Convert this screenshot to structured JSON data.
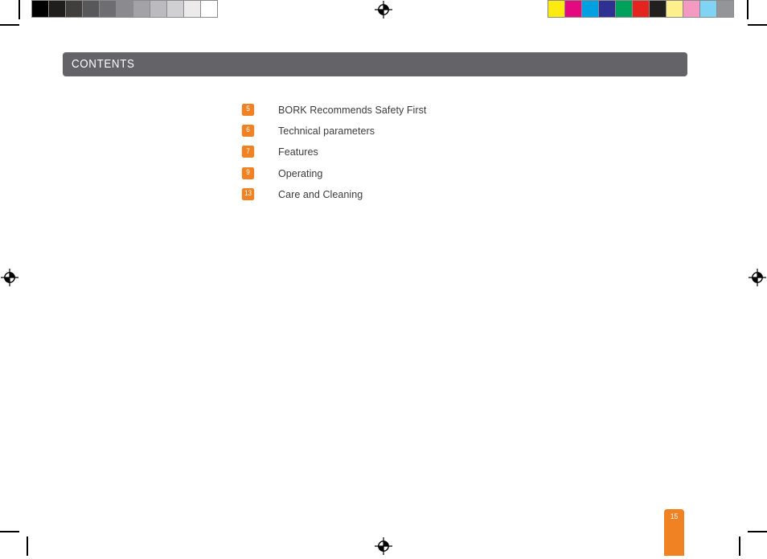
{
  "document": {
    "page_number": "15",
    "header_title": "CONTENTS",
    "header_color": "#636368",
    "accent_color": "#f08223",
    "text_color": "#3b3b3d"
  },
  "contents": {
    "entries": [
      {
        "page": "5",
        "label": "BORK Recommends Safety First"
      },
      {
        "page": "6",
        "label": "Technical parameters"
      },
      {
        "page": "7",
        "label": "Features"
      },
      {
        "page": "9",
        "label": "Operating"
      },
      {
        "page": "13",
        "label": "Care and Cleaning"
      }
    ]
  },
  "print_marks": {
    "grayscale_strip": [
      "#000000",
      "#1f1e1d",
      "#403f3e",
      "#58575a",
      "#6e6d72",
      "#8b8a8e",
      "#a3a2a6",
      "#bbbabe",
      "#d0cfd2",
      "#eceaea",
      "#ffffff"
    ],
    "color_strip": [
      "#fcea10",
      "#e5097f",
      "#00a0e3",
      "#2e3191",
      "#00a15a",
      "#e52420",
      "#221f1f",
      "#fdf08a",
      "#f49ac2",
      "#7fd4f4",
      "#939598"
    ],
    "registration_icon": "registration-target-icon"
  }
}
